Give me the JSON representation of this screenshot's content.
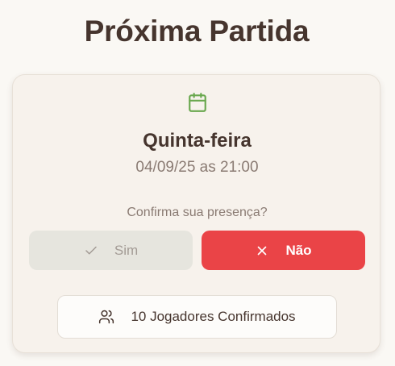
{
  "page": {
    "title": "Próxima Partida"
  },
  "match": {
    "icon": "calendar-icon",
    "weekday": "Quinta-feira",
    "datetime": "04/09/25 as 21:00"
  },
  "attendance": {
    "question": "Confirma sua presença?",
    "yes_label": "Sim",
    "yes_icon": "check-icon",
    "no_label": "Não",
    "no_icon": "close-icon",
    "selected": "no"
  },
  "players": {
    "confirmed_label": "10 Jogadores Confirmados",
    "icon": "users-icon"
  },
  "colors": {
    "accent_green": "#6aa84f",
    "decline_red": "#ea4447",
    "text_dark": "#46352e",
    "text_muted": "#8a7b73"
  }
}
